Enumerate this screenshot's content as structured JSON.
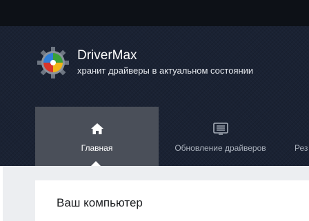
{
  "app": {
    "name": "DriverMax",
    "tagline": "хранит драйверы в актуальном состоянии"
  },
  "tabs": [
    {
      "label": "Главная",
      "icon": "home-icon",
      "active": true
    },
    {
      "label": "Обновление драйверов",
      "icon": "driver-update-icon",
      "active": false
    },
    {
      "label": "Рез",
      "icon": "",
      "active": false
    }
  ],
  "main": {
    "card_title": "Ваш компьютер"
  },
  "colors": {
    "header_bg": "#1a2233",
    "active_tab": "#4a4f59",
    "content_bg": "#eceef1"
  }
}
